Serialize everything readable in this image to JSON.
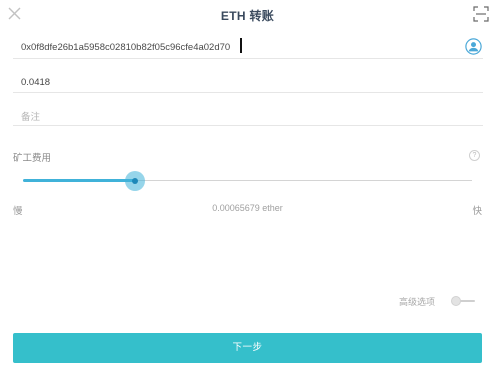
{
  "header": {
    "title": "ETH 转账",
    "close_icon": "close-icon",
    "scan_icon": "scan-icon"
  },
  "form": {
    "address_value": "0x0f8dfe26b1a5958c02810b82f05c96cfe4a02d70",
    "contact_icon": "contact-icon",
    "amount_value": "0.0418",
    "memo_placeholder": "备注"
  },
  "fee": {
    "label": "矿工费用",
    "help_icon": "help-icon",
    "help_glyph": "?",
    "slider_value": 0.25,
    "slow_label": "慢",
    "fast_label": "快",
    "value_text": "0.00065679 ether"
  },
  "advanced": {
    "label": "高级选项",
    "enabled": false
  },
  "actions": {
    "next_label": "下一步"
  },
  "colors": {
    "accent": "#35bfcb",
    "slider": "#40b2d9",
    "title": "#3a4a5e"
  }
}
